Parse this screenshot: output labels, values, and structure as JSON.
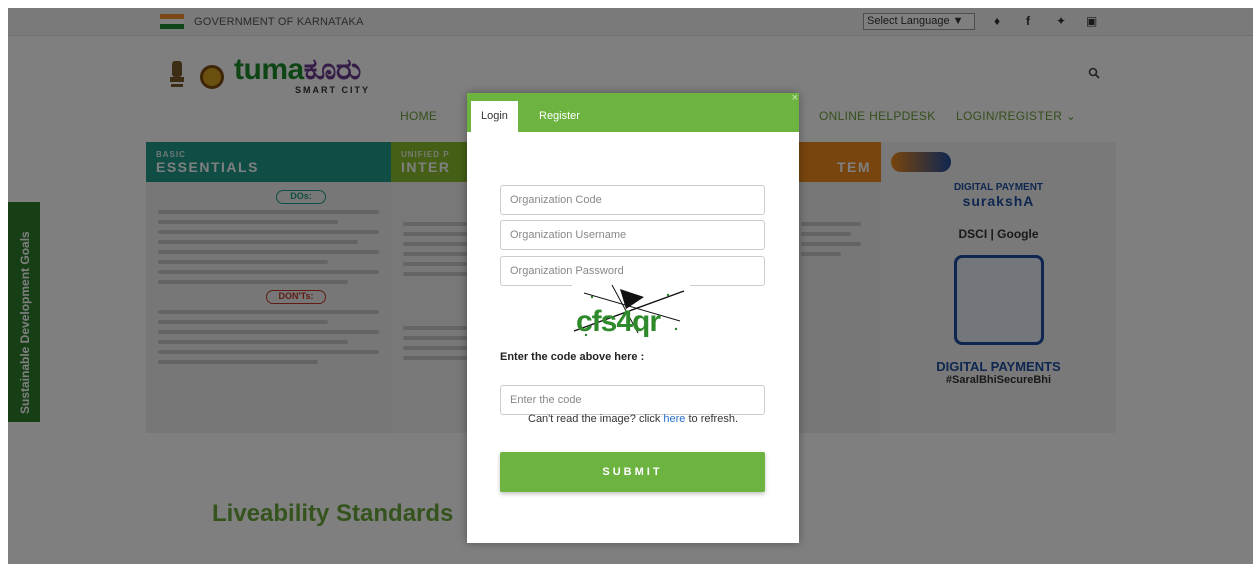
{
  "topbar": {
    "gov_label": "GOVERNMENT OF KARNATAKA",
    "language_select": "Select Language ▼",
    "social_icons": [
      "share-icon",
      "facebook-icon",
      "twitter-icon",
      "instagram-icon"
    ]
  },
  "header": {
    "logo_text": "tuma",
    "logo_text_kannada": "ಕೂರು",
    "logo_subtitle": "SMART CITY",
    "nav": {
      "home": "HOME",
      "helpdesk": "ONLINE HELPDESK",
      "login_register": "LOGIN/REGISTER ⌄"
    }
  },
  "banner": {
    "col1_small": "BASIC",
    "col1_big": "ESSENTIALS",
    "col1_dos": "DOs:",
    "col1_donts": "DON'Ts:",
    "col2_small": "UNIFIED P",
    "col2_big": "INTER",
    "col3_big": "TEM",
    "right_title": "DIGITAL PAYMENT",
    "right_brand": "surakshA",
    "right_partners": "DSCI | Google",
    "right_footer_title": "DIGITAL PAYMENTS",
    "right_hashtag": "#SaralBhiSecureBhi"
  },
  "side_tab": "Sustainable Development Goals",
  "section_heading": "Liveability Standards",
  "modal": {
    "tabs": {
      "login": "Login",
      "register": "Register"
    },
    "close": "×",
    "fields": {
      "org_code_placeholder": "Organization Code",
      "org_username_placeholder": "Organization Username",
      "org_password_placeholder": "Organization Password",
      "code_placeholder": "Enter the code"
    },
    "captcha_text": "cfs4qr",
    "code_label": "Enter the code above here :",
    "refresh_prefix": "Can't read the image? click ",
    "refresh_link": "here",
    "refresh_suffix": " to refresh.",
    "submit_label": "SUBMIT"
  },
  "colors": {
    "brand_green": "#6cb33f",
    "teal": "#1f9b8a",
    "lime": "#8cbf2f",
    "orange": "#f08a1c",
    "link_blue": "#2a6fc9"
  }
}
